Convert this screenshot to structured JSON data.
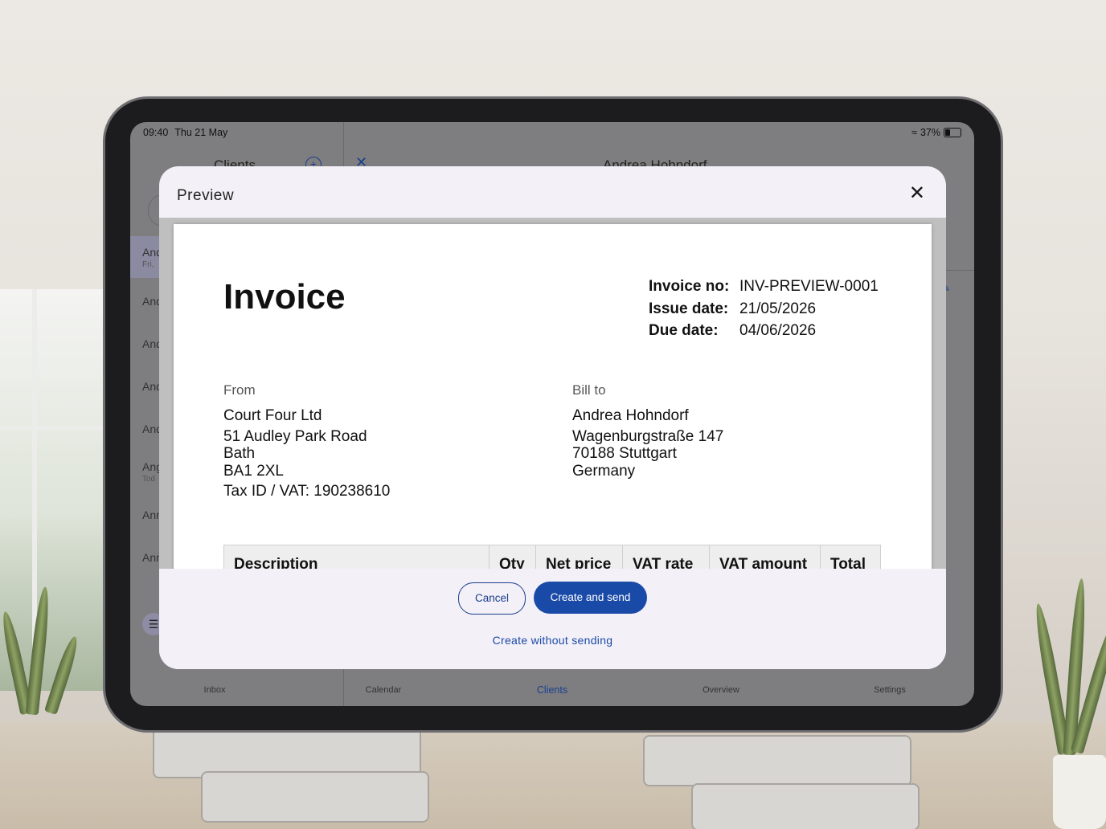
{
  "status_bar": {
    "time": "09:40",
    "date": "Thu 21 May",
    "battery": "37%"
  },
  "clients_panel": {
    "title": "Clients",
    "rows": [
      {
        "name": "And",
        "sub": "Fri,"
      },
      {
        "name": "And",
        "sub": ""
      },
      {
        "name": "And",
        "sub": ""
      },
      {
        "name": "And",
        "sub": ""
      },
      {
        "name": "And",
        "sub": ""
      },
      {
        "name": "Ang",
        "sub": "Tod"
      },
      {
        "name": "Ann",
        "sub": ""
      },
      {
        "name": "Ann",
        "sub": ""
      }
    ]
  },
  "detail": {
    "title": "Andrea Hohndorf"
  },
  "tabs": [
    {
      "label": "Inbox"
    },
    {
      "label": "Calendar"
    },
    {
      "label": "Clients"
    },
    {
      "label": "Overview"
    },
    {
      "label": "Settings"
    }
  ],
  "modal": {
    "title": "Preview",
    "invoice": {
      "heading": "Invoice",
      "meta": [
        {
          "key": "Invoice no:",
          "value": "INV-PREVIEW-0001"
        },
        {
          "key": "Issue date:",
          "value": "21/05/2026"
        },
        {
          "key": "Due date:",
          "value": "04/06/2026"
        }
      ],
      "from": {
        "label": "From",
        "name": "Court Four Ltd",
        "address": [
          "51 Audley Park Road",
          "Bath",
          "BA1 2XL"
        ],
        "tax": "Tax ID / VAT: 190238610"
      },
      "bill_to": {
        "label": "Bill to",
        "name": "Andrea Hohndorf",
        "address": [
          "Wagenburgstraße 147",
          "70188 Stuttgart",
          "Germany"
        ]
      },
      "columns": [
        "Description",
        "Qty",
        "Net price",
        "VAT rate",
        "VAT amount",
        "Total"
      ]
    },
    "cancel_label": "Cancel",
    "send_label": "Create and send",
    "nosend_label": "Create without sending"
  }
}
